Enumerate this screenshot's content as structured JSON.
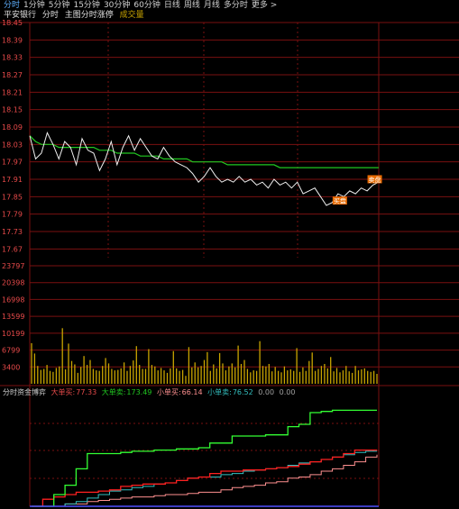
{
  "tabs": [
    "分时",
    "1分钟",
    "5分钟",
    "15分钟",
    "30分钟",
    "60分钟",
    "日线",
    "周线",
    "月线",
    "多分时",
    "更多 >"
  ],
  "active_tab": 0,
  "subheader": {
    "stock": "平安银行",
    "mode": "分时",
    "overlay": "主图分时涨停",
    "volume": "成交量"
  },
  "colors": {
    "up": "#e84a4a",
    "avg": "#21c821",
    "price": "#f0f0f0",
    "vol": "#c8a400",
    "blue": "#5fb0ff",
    "grid": "#7a1010"
  },
  "chart_data": {
    "type": "line",
    "price_ticks": [
      "18.45",
      "18.39",
      "18.33",
      "18.27",
      "18.21",
      "18.15",
      "18.09",
      "18.03",
      "17.97",
      "17.91",
      "17.85",
      "17.79",
      "17.73",
      "17.67"
    ],
    "price_range": [
      17.64,
      18.45
    ],
    "price": [
      18.06,
      17.98,
      18.0,
      18.07,
      18.03,
      17.98,
      18.04,
      18.02,
      17.96,
      18.05,
      18.01,
      18.0,
      17.94,
      17.98,
      18.04,
      17.96,
      18.02,
      18.06,
      18.01,
      18.05,
      18.02,
      17.99,
      17.98,
      18.02,
      17.99,
      17.97,
      17.96,
      17.95,
      17.93,
      17.9,
      17.92,
      17.95,
      17.92,
      17.9,
      17.91,
      17.9,
      17.92,
      17.9,
      17.91,
      17.89,
      17.9,
      17.88,
      17.91,
      17.89,
      17.9,
      17.88,
      17.9,
      17.86,
      17.87,
      17.88,
      17.85,
      17.82,
      17.83,
      17.86,
      17.85,
      17.87,
      17.86,
      17.88,
      17.87,
      17.89,
      17.9
    ],
    "avg": [
      18.06,
      18.04,
      18.03,
      18.03,
      18.03,
      18.02,
      18.02,
      18.02,
      18.02,
      18.02,
      18.02,
      18.02,
      18.01,
      18.01,
      18.01,
      18.0,
      18.0,
      18.0,
      18.0,
      17.99,
      17.99,
      17.99,
      17.99,
      17.98,
      17.98,
      17.98,
      17.98,
      17.98,
      17.97,
      17.97,
      17.97,
      17.97,
      17.97,
      17.97,
      17.96,
      17.96,
      17.96,
      17.96,
      17.96,
      17.96,
      17.96,
      17.96,
      17.96,
      17.95,
      17.95,
      17.95,
      17.95,
      17.95,
      17.95,
      17.95,
      17.95,
      17.95,
      17.95,
      17.95,
      17.95,
      17.95,
      17.95,
      17.95,
      17.95,
      17.95,
      17.95
    ],
    "markers": [
      {
        "label": "买盘",
        "index": 53
      },
      {
        "label": "卖盘",
        "index": 59
      }
    ],
    "volume_ticks": [
      "23797",
      "20398",
      "16998",
      "13599",
      "10199",
      "6799",
      "3400"
    ],
    "volume_range": [
      0,
      23797
    ],
    "volume": [
      8200,
      6100,
      3600,
      2800,
      3000,
      3800,
      2600,
      2400,
      3200,
      3500,
      11200,
      2900,
      8100,
      4600,
      3900,
      2200,
      3400,
      5600,
      3800,
      4800,
      3000,
      2700,
      2600,
      3600,
      5200,
      4100,
      3000,
      2700,
      2800,
      3100,
      4300,
      2600,
      3600,
      4700,
      7600,
      3800,
      3000,
      3000,
      7000,
      3800,
      3500,
      2700,
      3200,
      2700,
      2200,
      3100,
      6600,
      3100,
      2600,
      2800,
      1600,
      7400,
      3300,
      4300,
      3300,
      3600,
      4800,
      6400,
      2600,
      3900,
      3100,
      6200,
      4100,
      2700,
      3500,
      4100,
      3300,
      7700,
      4000,
      4800,
      3000,
      2300,
      2700,
      2600,
      8600,
      3600,
      3500,
      4000,
      2500,
      3400,
      2600,
      2300,
      3500,
      2700,
      2900,
      2600,
      7200,
      2400,
      3300,
      2600,
      4600,
      6300,
      2600,
      3000,
      3600,
      4000,
      3100,
      5400,
      2500,
      3200,
      2300,
      2700,
      3600,
      2500,
      2200,
      3600,
      2700,
      2900,
      3100,
      2600,
      2400,
      2600,
      2000
    ],
    "flow_legend": {
      "title": "分时资金博弈",
      "big_buy_label": "大单买:",
      "big_buy": "77.33",
      "big_sell_label": "大单卖:",
      "big_sell": "173.49",
      "small_buy_label": "小单买:",
      "small_buy": "66.14",
      "small_sell_label": "小单卖:",
      "small_sell": "76.52",
      "extra1": "0.00",
      "extra2": "0.00"
    },
    "flow_green": [
      0,
      0,
      10,
      18,
      32,
      45,
      45,
      45,
      46,
      47,
      47,
      48,
      48,
      49,
      49,
      50,
      54,
      54,
      60,
      60,
      60,
      61,
      61,
      68,
      70,
      80,
      81,
      82,
      82,
      82,
      82,
      82
    ],
    "flow_red": [
      0,
      6,
      8,
      10,
      12,
      12,
      13,
      14,
      17,
      18,
      19,
      19,
      20,
      22,
      24,
      25,
      28,
      30,
      30,
      31,
      31,
      32,
      33,
      34,
      36,
      38,
      40,
      42,
      45,
      48,
      48,
      48
    ],
    "flow_cyan": [
      0,
      0,
      0,
      2,
      4,
      7,
      10,
      13,
      14,
      16,
      17,
      19,
      20,
      22,
      24,
      25,
      25,
      27,
      28,
      30,
      31,
      32,
      33,
      35,
      37,
      38,
      40,
      42,
      44,
      46,
      47,
      47
    ],
    "flow_pink": [
      0,
      0,
      0,
      2,
      2,
      4,
      5,
      6,
      7,
      8,
      8,
      9,
      10,
      10,
      11,
      12,
      12,
      14,
      16,
      17,
      18,
      20,
      21,
      24,
      25,
      27,
      30,
      32,
      35,
      38,
      42,
      44
    ]
  }
}
